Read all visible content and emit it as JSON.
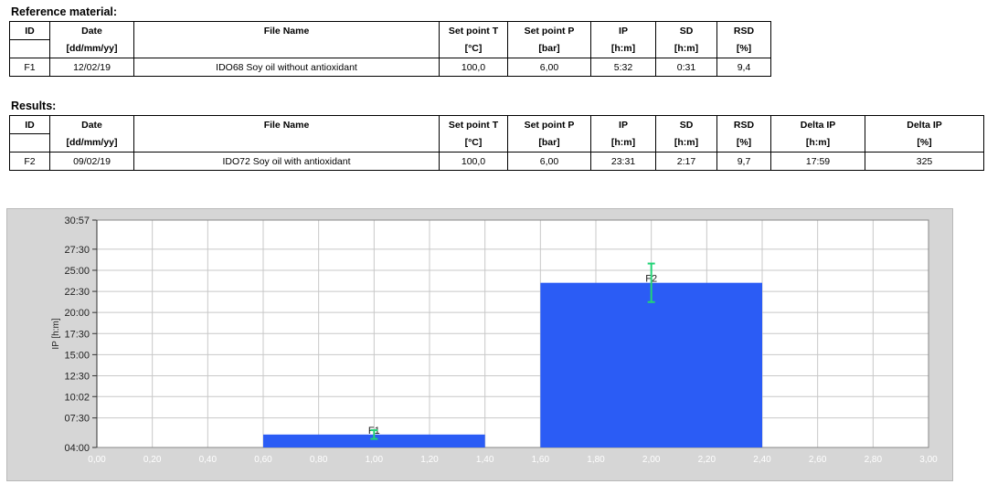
{
  "reference": {
    "title": "Reference material:",
    "headers": [
      "ID",
      "Date",
      "File Name",
      "Set point T",
      "Set point P",
      "IP",
      "SD",
      "RSD"
    ],
    "units": [
      "",
      "[dd/mm/yy]",
      "",
      "[°C]",
      "[bar]",
      "[h:m]",
      "[h:m]",
      "[%]"
    ],
    "rows": [
      [
        "F1",
        "12/02/19",
        "IDO68 Soy oil without antioxidant",
        "100,0",
        "6,00",
        "5:32",
        "0:31",
        "9,4"
      ]
    ]
  },
  "results": {
    "title": "Results:",
    "headers": [
      "ID",
      "Date",
      "File Name",
      "Set point T",
      "Set point P",
      "IP",
      "SD",
      "RSD",
      "Delta IP",
      "Delta IP"
    ],
    "units": [
      "",
      "[dd/mm/yy]",
      "",
      "[°C]",
      "[bar]",
      "[h:m]",
      "[h:m]",
      "[%]",
      "[h:m]",
      "[%]"
    ],
    "rows": [
      [
        "F2",
        "09/02/19",
        "IDO72 Soy oil with antioxidant",
        "100,0",
        "6,00",
        "23:31",
        "2:17",
        "9,7",
        "17:59",
        "325"
      ]
    ]
  },
  "chart_data": {
    "type": "bar",
    "ylabel": "IP [h:m]",
    "xlabel": "",
    "y_unit": "minutes",
    "ylim": [
      240,
      1857
    ],
    "xlim": [
      0,
      3
    ],
    "y_ticks": [
      {
        "label": "30:57",
        "value": 1857
      },
      {
        "label": "27:30",
        "value": 1650
      },
      {
        "label": "25:00",
        "value": 1500
      },
      {
        "label": "22:30",
        "value": 1350
      },
      {
        "label": "20:00",
        "value": 1200
      },
      {
        "label": "17:30",
        "value": 1050
      },
      {
        "label": "15:00",
        "value": 900
      },
      {
        "label": "12:30",
        "value": 750
      },
      {
        "label": "10:02",
        "value": 602
      },
      {
        "label": "07:30",
        "value": 450
      },
      {
        "label": "04:00",
        "value": 240
      }
    ],
    "x_ticks": [
      "0,00",
      "0,20",
      "0,40",
      "0,60",
      "0,80",
      "1,00",
      "1,20",
      "1,40",
      "1,60",
      "1,80",
      "2,00",
      "2,20",
      "2,40",
      "2,60",
      "2,80",
      "3,00"
    ],
    "grid": true,
    "bars": [
      {
        "label": "F1",
        "x_center": 1.0,
        "x_start": 0.6,
        "x_end": 1.4,
        "value": 332,
        "sd": 31
      },
      {
        "label": "F2",
        "x_center": 2.0,
        "x_start": 1.6,
        "x_end": 2.4,
        "value": 1411,
        "sd": 137
      }
    ],
    "colors": {
      "bar": "#2b5cf5",
      "error_bar": "#22d477",
      "plot_bg": "#ffffff",
      "panel_bg": "#d6d6d6",
      "grid": "#c8c8c8"
    }
  }
}
